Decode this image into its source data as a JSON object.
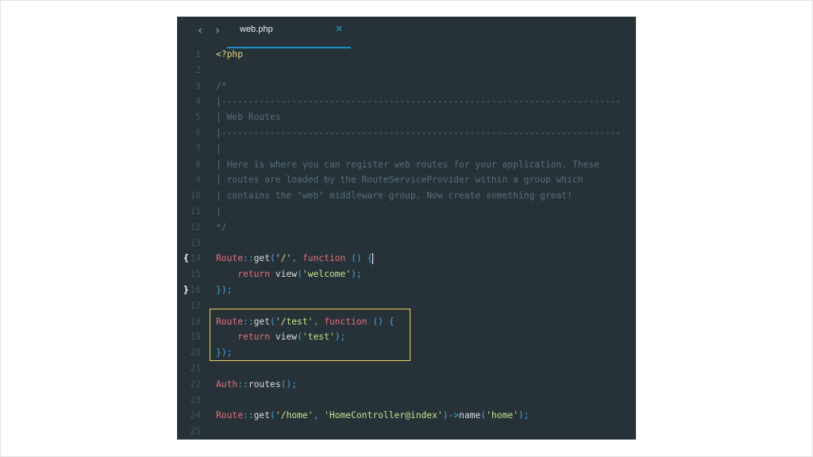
{
  "tab": {
    "filename": "web.php",
    "close_symbol": "×"
  },
  "nav": {
    "back": "‹",
    "forward": "›"
  },
  "fold_markers": {
    "open": "{",
    "close": "}"
  },
  "lines": [
    {
      "n": "1",
      "text": "<?php"
    },
    {
      "n": "2",
      "text": ""
    },
    {
      "n": "3",
      "text": "/*"
    },
    {
      "n": "4",
      "text": "|--------------------------------------------------------------------------"
    },
    {
      "n": "5",
      "text": "| Web Routes"
    },
    {
      "n": "6",
      "text": "|--------------------------------------------------------------------------"
    },
    {
      "n": "7",
      "text": "|"
    },
    {
      "n": "8",
      "text": "| Here is where you can register web routes for your application. These"
    },
    {
      "n": "9",
      "text": "| routes are loaded by the RouteServiceProvider within a group which"
    },
    {
      "n": "10",
      "text": "| contains the \"web\" middleware group. Now create something great!"
    },
    {
      "n": "11",
      "text": "|"
    },
    {
      "n": "12",
      "text": "*/"
    },
    {
      "n": "13",
      "text": ""
    },
    {
      "n": "14",
      "text": "Route::get('/', function () {"
    },
    {
      "n": "15",
      "text": "    return view('welcome');"
    },
    {
      "n": "16",
      "text": "});"
    },
    {
      "n": "17",
      "text": ""
    },
    {
      "n": "18",
      "text": "Route::get('/test', function () {"
    },
    {
      "n": "19",
      "text": "    return view('test');"
    },
    {
      "n": "20",
      "text": "});"
    },
    {
      "n": "21",
      "text": ""
    },
    {
      "n": "22",
      "text": "Auth::routes();"
    },
    {
      "n": "23",
      "text": ""
    },
    {
      "n": "24",
      "text": "Route::get('/home', 'HomeController@index')->name('home');"
    },
    {
      "n": "25",
      "text": ""
    }
  ],
  "colors": {
    "editor_bg": "#263238",
    "comment": "#546e7a",
    "keyword": "#e56e82",
    "string": "#c5e48b",
    "punctuation": "#4aa3d8",
    "highlight_border": "#f0d060",
    "tab_underline": "#1b8fc6"
  }
}
